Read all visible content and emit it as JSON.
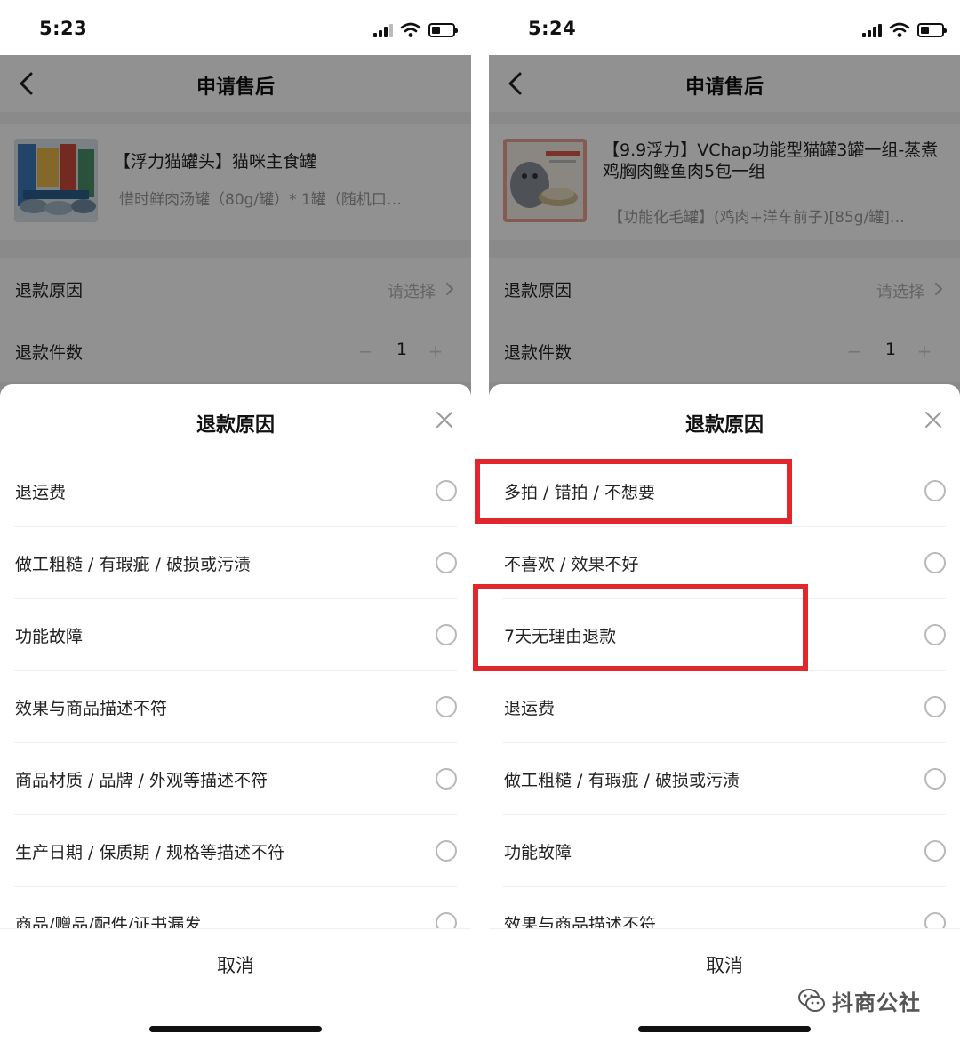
{
  "colors": {
    "highlight": "#e2272c",
    "overlay": "rgba(0,0,0,0.43)",
    "radio_border": "#b8b8b8"
  },
  "icons": [
    "back-chevron",
    "chevron-right",
    "close-x",
    "signal",
    "wifi",
    "battery",
    "wechat-watermark"
  ],
  "left": {
    "status_time": "5:23",
    "nav_title": "申请售后",
    "product": {
      "title": "【浮力猫罐头】猫咪主食罐",
      "spec": "惜时鲜肉汤罐（80g/罐）* 1罐（随机口…"
    },
    "form": {
      "reason_label": "退款原因",
      "reason_hint": "请选择",
      "qty_label": "退款件数",
      "qty_minus": "−",
      "qty_value": "1",
      "qty_plus": "+"
    },
    "sheet": {
      "title": "退款原因",
      "reasons": [
        "退运费",
        "做工粗糙 / 有瑕疵 / 破损或污渍",
        "功能故障",
        "效果与商品描述不符",
        "商品材质 / 品牌 / 外观等描述不符",
        "生产日期 / 保质期 / 规格等描述不符",
        "商品/赠品/配件/证书漏发"
      ],
      "cancel": "取消"
    }
  },
  "right": {
    "status_time": "5:24",
    "nav_title": "申请售后",
    "product": {
      "title": "【9.9浮力】VChap功能型猫罐3罐一组-蒸煮鸡胸肉鲣鱼肉5包一组",
      "spec": "【功能化毛罐】(鸡肉+洋车前子)[85g/罐]…"
    },
    "form": {
      "reason_label": "退款原因",
      "reason_hint": "请选择",
      "qty_label": "退款件数",
      "qty_minus": "−",
      "qty_value": "1",
      "qty_plus": "+"
    },
    "sheet": {
      "title": "退款原因",
      "reasons": [
        "多拍 / 错拍 / 不想要",
        "不喜欢 / 效果不好",
        "7天无理由退款",
        "退运费",
        "做工粗糙 / 有瑕疵 / 破损或污渍",
        "功能故障",
        "效果与商品描述不符"
      ],
      "cancel": "取消"
    }
  },
  "watermark": {
    "text": "抖商公社"
  }
}
